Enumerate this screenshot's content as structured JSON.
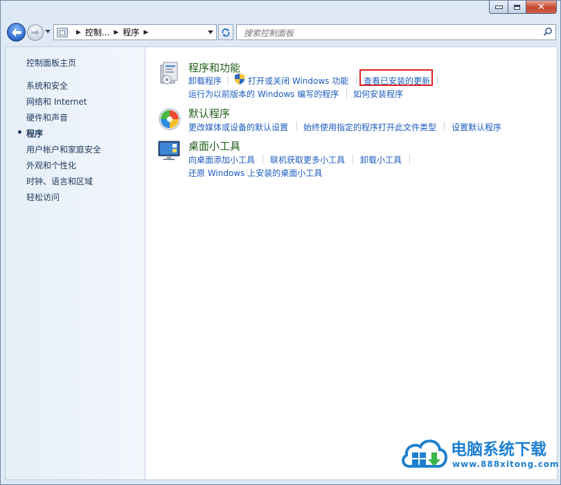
{
  "window": {
    "caption": {
      "minimize_icon": "minimize-icon",
      "maximize_icon": "maximize-icon",
      "close_icon": "close-icon",
      "close_color": "#c7462f"
    }
  },
  "addressbar": {
    "crumbs": [
      "控制...",
      "程序"
    ],
    "search_placeholder": "搜索控制面板"
  },
  "sidebar": {
    "items": [
      {
        "label": "控制面板主页"
      },
      {
        "label": "系统和安全"
      },
      {
        "label": "网络和 Internet"
      },
      {
        "label": "硬件和声音"
      },
      {
        "label": "程序",
        "current": true
      },
      {
        "label": "用户帐户和家庭安全"
      },
      {
        "label": "外观和个性化"
      },
      {
        "label": "时钟、语言和区域"
      },
      {
        "label": "轻松访问"
      }
    ]
  },
  "categories": [
    {
      "title": "程序和功能",
      "icon": "programs-features-icon",
      "tasks": [
        "卸载程序",
        "打开或关闭 Windows 功能",
        "查看已安装的更新",
        "运行为以前版本的 Windows 编写的程序",
        "如何安装程序"
      ]
    },
    {
      "title": "默认程序",
      "icon": "default-programs-icon",
      "tasks": [
        "更改媒体或设备的默认设置",
        "始终使用指定的程序打开此文件类型",
        "设置默认程序"
      ]
    },
    {
      "title": "桌面小工具",
      "icon": "desktop-gadgets-icon",
      "tasks": [
        "向桌面添加小工具",
        "联机获取更多小工具",
        "卸载小工具",
        "还原 Windows 上安装的桌面小工具"
      ]
    }
  ],
  "highlight_color": "#e02020",
  "watermark": {
    "title": "电脑系统下载",
    "url": "www.888xitong.com"
  },
  "colors": {
    "link": "#1a5bbf",
    "category_title": "#1e5e17",
    "sidebar_text": "#1e395b"
  }
}
